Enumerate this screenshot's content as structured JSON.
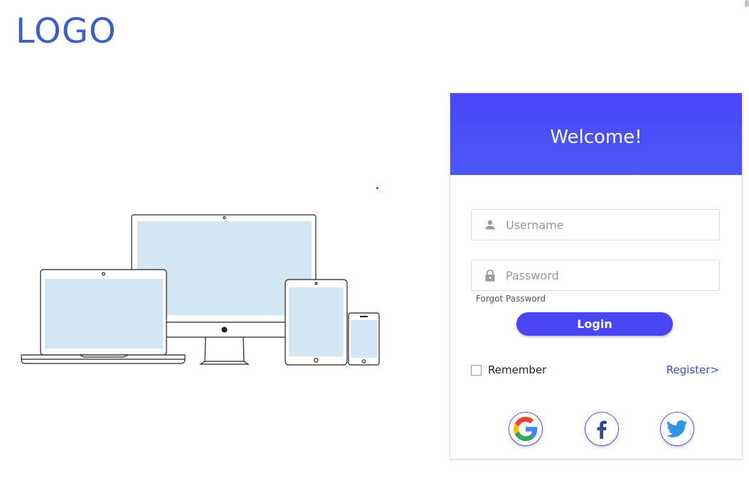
{
  "logo": {
    "text": "LOGO"
  },
  "card": {
    "title": "Welcome!",
    "username_placeholder": "Username",
    "password_placeholder": "Password",
    "forgot_password": "Forgot Password",
    "login_button": "Login",
    "remember_label": "Remember",
    "register_link": "Register>"
  },
  "social": {
    "icons": [
      "google-icon",
      "facebook-icon",
      "twitter-icon"
    ]
  },
  "colors": {
    "logo": "#3a60c8",
    "header": "#4b46fa",
    "button": "#4b46f5",
    "link": "#3a4ec0",
    "screen": "#d3e6f3"
  },
  "illustration": {
    "icons": [
      "laptop-icon",
      "monitor-icon",
      "tablet-icon",
      "phone-icon"
    ]
  }
}
